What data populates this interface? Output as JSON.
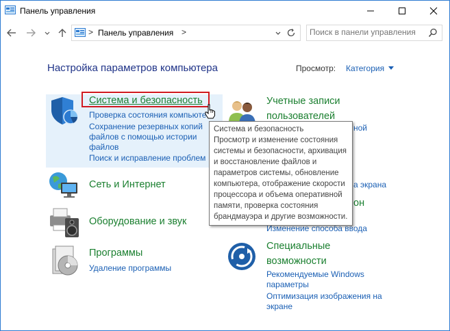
{
  "window": {
    "title": "Панель управления",
    "controls": [
      "minimize",
      "maximize",
      "close"
    ]
  },
  "navigation": {
    "back": "back-arrow",
    "forward": "forward-arrow",
    "recent": "chevron-down",
    "up": "up-arrow",
    "address": {
      "separator": ">",
      "path": "Панель управления",
      "trailing_separator": ">"
    },
    "search": {
      "placeholder": "Поиск в панели управления"
    }
  },
  "main": {
    "heading": "Настройка параметров компьютера",
    "view_by": {
      "label": "Просмотр:",
      "value": "Категория"
    },
    "categories": {
      "system": {
        "title": "Система и безопасность",
        "links": [
          "Проверка состояния компьюте",
          "Сохранение резервных копий",
          "файлов с помощью истории",
          "файлов",
          "Поиск и исправление проблем"
        ]
      },
      "network": {
        "title": "Сеть и Интернет"
      },
      "hardware": {
        "title": "Оборудование и звук"
      },
      "programs": {
        "title": "Программы",
        "links": [
          "Удаление программы"
        ]
      },
      "accounts": {
        "title_line1": "Учетные записи",
        "title_line2": "пользователей",
        "partial_link": "ной"
      },
      "appearance": {
        "partial_link": "а экрана"
      },
      "clock": {
        "partial_title": "он",
        "partial_link": "Изменение способа ввода"
      },
      "access": {
        "title_line1": "Специальные",
        "title_line2": "возможности",
        "links": [
          "Рекомендуемые Windows",
          "параметры",
          "Оптимизация изображения на",
          "экране"
        ]
      }
    }
  },
  "tooltip": {
    "text": "Система и безопасность\nПросмотр и изменение состояния системы и безопасности, архивация и восстановление файлов и параметров системы, обновление компьютера, отображение скорости процессора и объема оперативной памяти, проверка состояния брандмауэра и другие возможности."
  },
  "colors": {
    "category_title": "#1a7f2f",
    "link": "#1a5fb4",
    "heading": "#1e3287",
    "highlight": "#e5f1fb",
    "focus_border": "#d0191f"
  }
}
